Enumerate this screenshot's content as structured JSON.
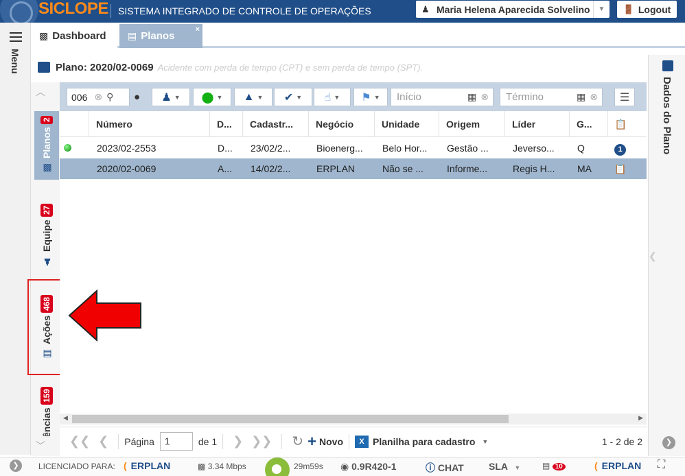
{
  "header": {
    "brand": "SICLOPE",
    "subtitle": "SISTEMA INTEGRADO DE CONTROLE DE OPERAÇÕES",
    "user_name": "Maria Helena Aparecida Solvelino",
    "logout_label": "Logout"
  },
  "menu": {
    "label": "Menu"
  },
  "tabs": [
    {
      "label": "Dashboard"
    },
    {
      "label": "Planos",
      "close": "×"
    }
  ],
  "plan": {
    "title": "Plano: 2020/02-0069",
    "description": "Acidente com perda de tempo (CPT) e sem perda de tempo (SPT)."
  },
  "side_tabs": {
    "planos": {
      "label": "Planos",
      "count": "2"
    },
    "equipe": {
      "label": "Equipe",
      "count": "27"
    },
    "acoes": {
      "label": "Ações",
      "count": "468"
    },
    "ocorrencias": {
      "label": "Ocorrências",
      "count": "159"
    }
  },
  "filters": {
    "search_value": "006",
    "start_placeholder": "Início",
    "end_placeholder": "Término"
  },
  "grid": {
    "columns": [
      "Número",
      "D...",
      "Cadastr...",
      "Negócio",
      "Unidade",
      "Origem",
      "Líder",
      "G..."
    ],
    "rows": [
      {
        "numero": "2023/02-2553",
        "d": "D...",
        "cadastro": "23/02/2...",
        "negocio": "Bioenerg...",
        "unidade": "Belo Hor...",
        "origem": "Gestão ...",
        "lider": "Jeverso...",
        "g": "Q",
        "badge": "1",
        "status": "green"
      },
      {
        "numero": "2020/02-0069",
        "d": "A...",
        "cadastro": "14/02/2...",
        "negocio": "ERPLAN",
        "unidade": "Não se ...",
        "origem": "Informe...",
        "lider": "Regis H...",
        "g": "MA",
        "badge": "",
        "status": "none"
      }
    ]
  },
  "pager": {
    "page_label": "Página",
    "page_value": "1",
    "of_label": "de 1",
    "new_label": "Novo",
    "sheet_label": "Planilha para cadastro",
    "count_label": "1 - 2 de 2"
  },
  "right_panel": {
    "label": "Dados do Plano"
  },
  "footer": {
    "licensed_label": "LICENCIADO PARA:",
    "brand1": "ERPLAN",
    "speed": "3.34 Mbps",
    "timer": "29m59s",
    "version": "0.9R420-1",
    "chat": "CHAT",
    "sla": "SLA",
    "notif_count": "10",
    "brand2": "ERPLAN"
  },
  "colors": {
    "header_bg": "#1f4e89",
    "brand": "#ff8a1a",
    "selected_row": "#9fb6ce",
    "badge_red": "#d9001b",
    "highlight": "#e02020"
  }
}
